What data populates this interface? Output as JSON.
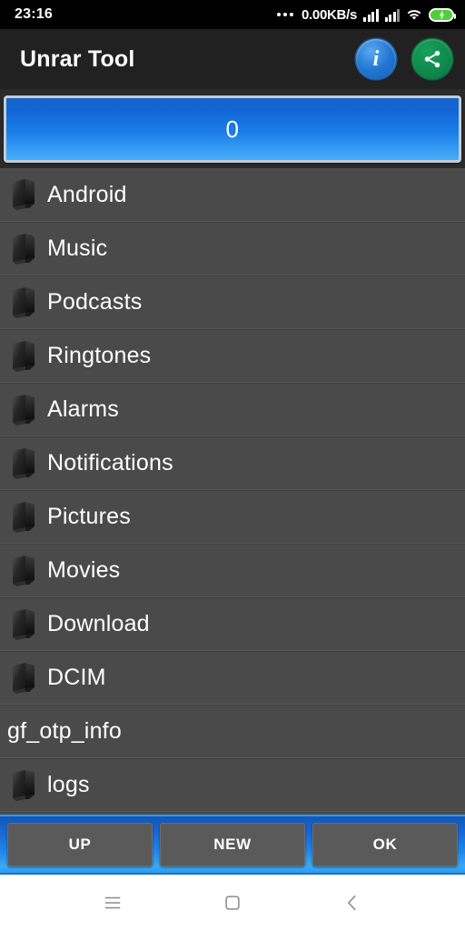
{
  "statusbar": {
    "clock": "23:16",
    "overflow_icon": "more-dots-icon",
    "network_speed": "0.00KB/s",
    "signal1_icon": "signal-bars-icon",
    "signal2_icon": "signal-bars-icon",
    "wifi_icon": "wifi-icon",
    "battery_icon": "battery-charging-icon"
  },
  "titlebar": {
    "title": "Unrar Tool",
    "info_icon": "info-icon",
    "share_icon": "share-icon"
  },
  "count_button": {
    "label": "0"
  },
  "filelist": {
    "items": [
      {
        "label": "Android",
        "icon": "folder-icon",
        "is_folder": true
      },
      {
        "label": "Music",
        "icon": "folder-icon",
        "is_folder": true
      },
      {
        "label": "Podcasts",
        "icon": "folder-icon",
        "is_folder": true
      },
      {
        "label": "Ringtones",
        "icon": "folder-icon",
        "is_folder": true
      },
      {
        "label": "Alarms",
        "icon": "folder-icon",
        "is_folder": true
      },
      {
        "label": "Notifications",
        "icon": "folder-icon",
        "is_folder": true
      },
      {
        "label": "Pictures",
        "icon": "folder-icon",
        "is_folder": true
      },
      {
        "label": "Movies",
        "icon": "folder-icon",
        "is_folder": true
      },
      {
        "label": "Download",
        "icon": "folder-icon",
        "is_folder": true
      },
      {
        "label": "DCIM",
        "icon": "folder-icon",
        "is_folder": true
      },
      {
        "label": "gf_otp_info",
        "icon": "",
        "is_folder": false
      },
      {
        "label": "logs",
        "icon": "folder-icon",
        "is_folder": true
      }
    ]
  },
  "bottombar": {
    "buttons": [
      {
        "label": "UP"
      },
      {
        "label": "NEW"
      },
      {
        "label": "OK"
      }
    ]
  },
  "navbar": {
    "recents_icon": "menu-icon",
    "home_icon": "square-home-icon",
    "back_icon": "chevron-left-icon"
  },
  "colors": {
    "status_bg": "#000000",
    "title_bg": "#212121",
    "list_bg": "#4a4a4a",
    "accent_blue": "#1f86ea",
    "info_blue": "#2176d2",
    "share_green": "#0e8a4c",
    "battery_green": "#4cd137",
    "button_gray": "#5a5a5a",
    "nav_bg": "#ffffff"
  }
}
